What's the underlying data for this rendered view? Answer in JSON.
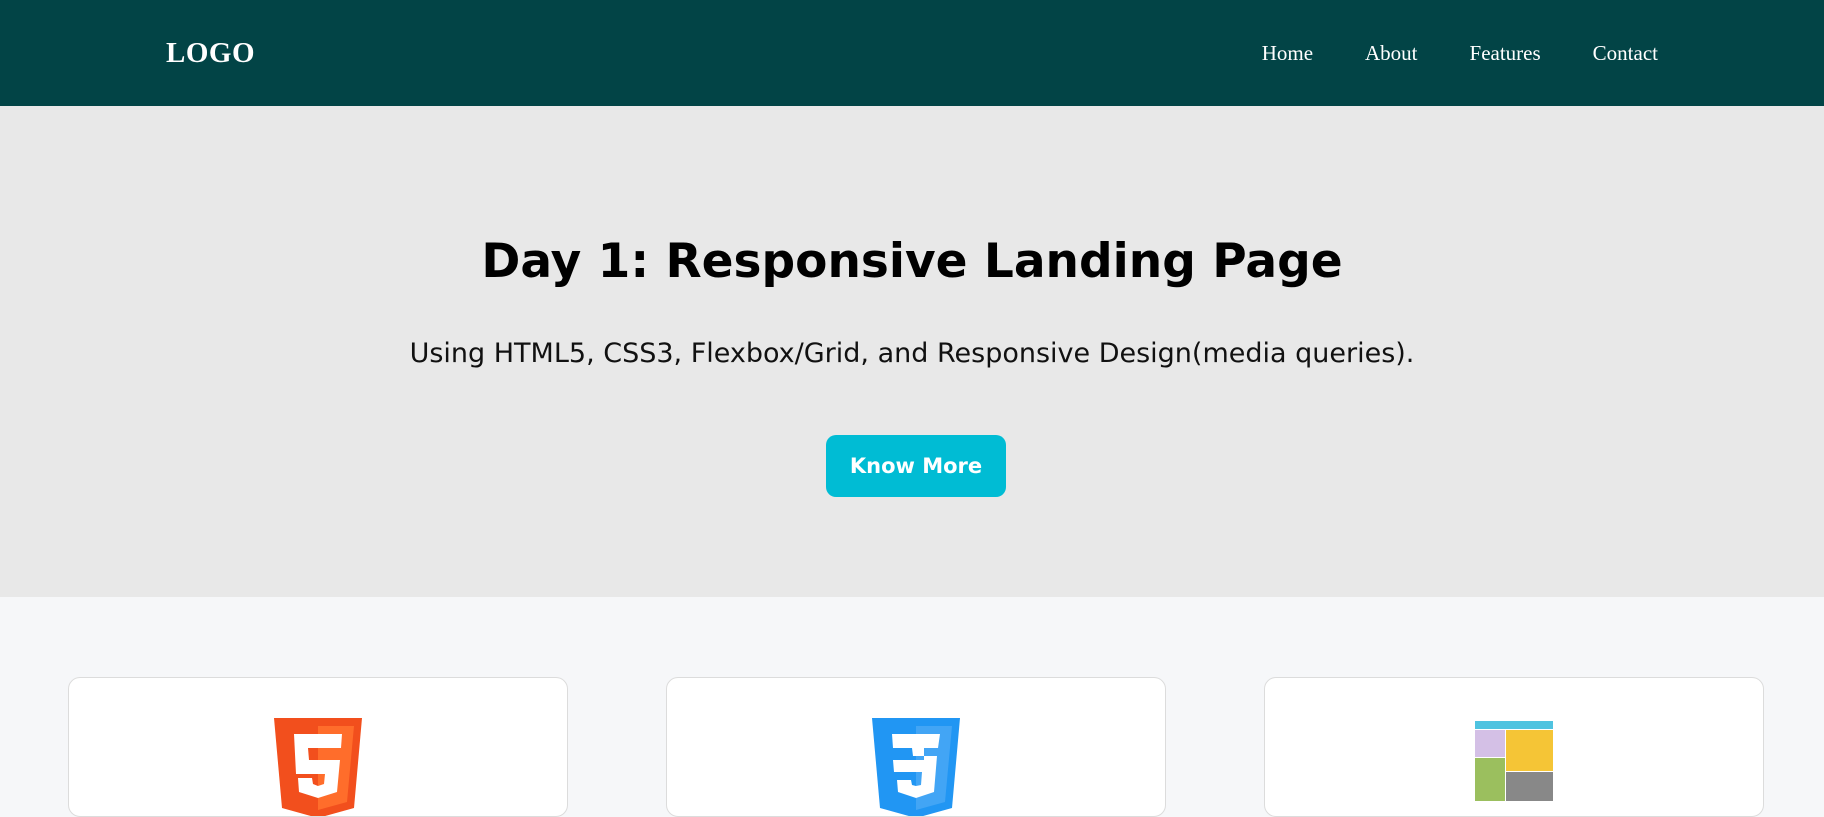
{
  "header": {
    "logo": "LOGO",
    "nav": [
      "Home",
      "About",
      "Features",
      "Contact"
    ]
  },
  "hero": {
    "title": "Day 1: Responsive Landing Page",
    "subtitle": "Using HTML5, CSS3, Flexbox/Grid, and Responsive Design(media queries).",
    "button_label": "Know More"
  },
  "features": {
    "cards": [
      {
        "icon": "html5-icon"
      },
      {
        "icon": "css3-icon"
      },
      {
        "icon": "css-grid-layout-icon"
      }
    ]
  },
  "colors": {
    "navbar": "#024446",
    "hero_bg": "#e8e8e8",
    "button": "#00bcd4",
    "html5_orange": "#f24f1d",
    "css3_blue": "#2196f3"
  }
}
